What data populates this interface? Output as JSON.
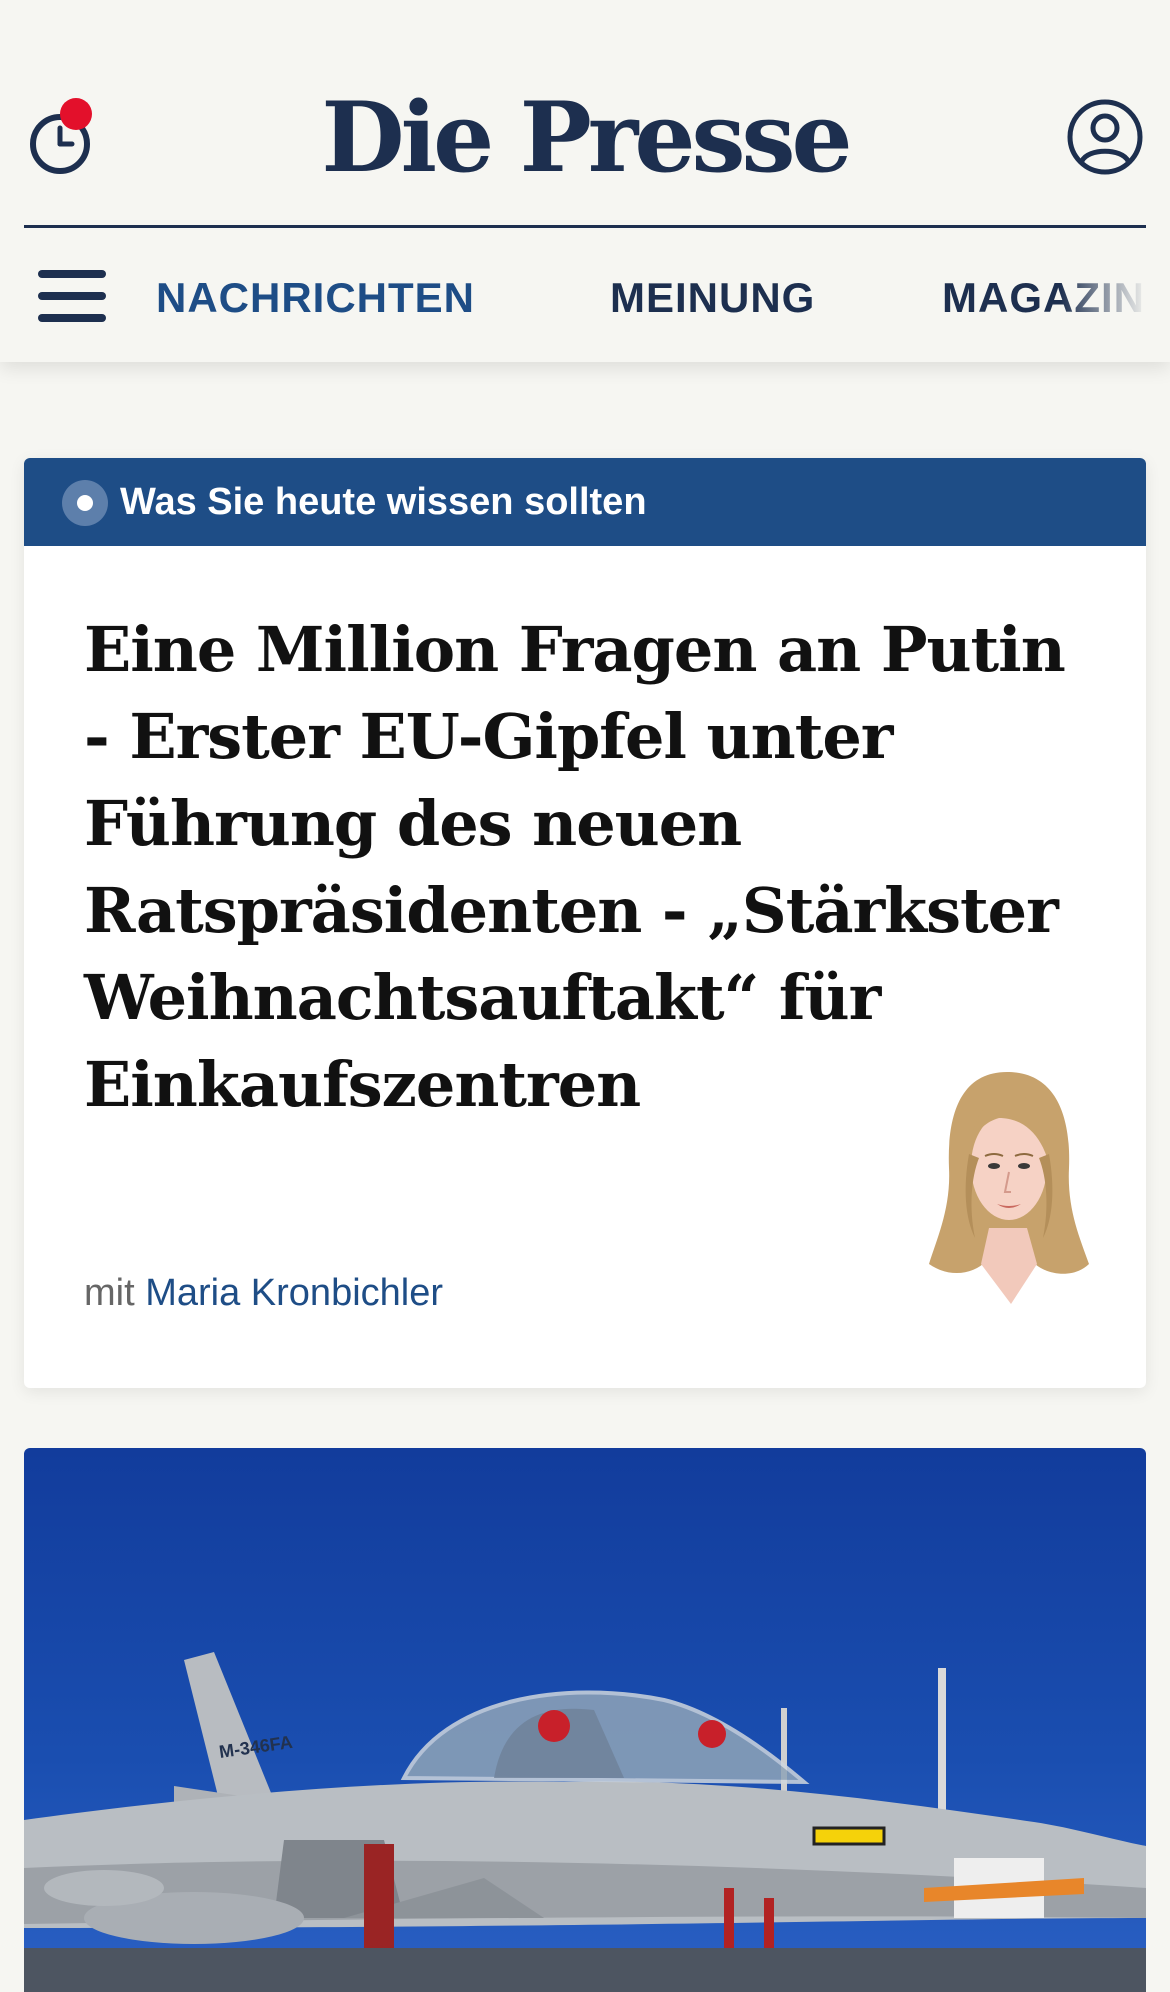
{
  "header": {
    "logo": "Die Presse",
    "clock_icon": "clock-icon",
    "notification_dot_color": "#e3102b",
    "user_icon": "user-account-icon",
    "menu_icon": "hamburger-menu-icon"
  },
  "nav": {
    "items": [
      {
        "label": "NACHRICHTEN",
        "active": true
      },
      {
        "label": "MEINUNG",
        "active": false
      },
      {
        "label": "MAGAZIN",
        "active": false
      }
    ]
  },
  "briefing": {
    "banner_label": "Was Sie heute wissen sollten",
    "title": "Eine Million Fragen an Putin - Erster EU-Gipfel unter Führung des neuen Ratspräsidenten - „Stärkster Weihnachtsauftakt“ für Einkaufszentren",
    "byline_prefix": "mit",
    "author": "Maria Kronbichler",
    "accent_color": "#1e4d86"
  },
  "hero": {
    "image_icon": "fighter-jet-photo",
    "aircraft_marking": "M-346FA"
  },
  "colors": {
    "background": "#f6f6f2",
    "navy": "#1d2f4f",
    "brand_blue": "#1e4d86"
  }
}
